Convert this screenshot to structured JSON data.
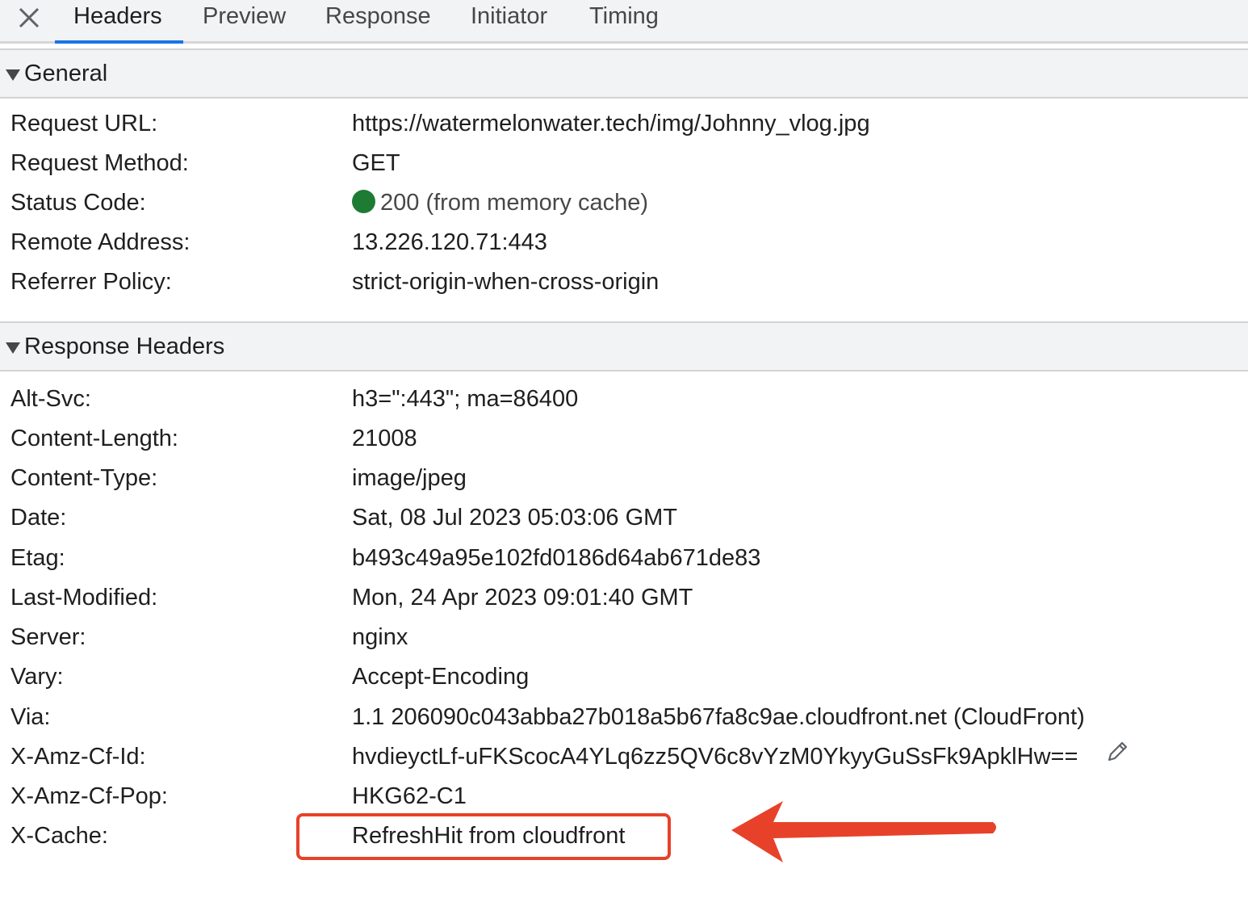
{
  "tabs": [
    {
      "label": "Headers",
      "active": true
    },
    {
      "label": "Preview"
    },
    {
      "label": "Response"
    },
    {
      "label": "Initiator"
    },
    {
      "label": "Timing"
    }
  ],
  "icons": {
    "close": "close-icon",
    "collapse": "triangle-down-icon",
    "edit": "pencil-icon",
    "annotation": "red-arrow-icon"
  },
  "colors": {
    "status_ok": "#1e7b34",
    "annotation": "#e8412a",
    "tab_accent": "#1a73e8"
  },
  "general": {
    "title": "General",
    "rows": [
      {
        "key": "Request URL:",
        "value": "https://watermelonwater.tech/img/Johnny_vlog.jpg"
      },
      {
        "key": "Request Method:",
        "value": "GET"
      },
      {
        "key": "Status Code:",
        "value": "200 (from memory cache)"
      },
      {
        "key": "Remote Address:",
        "value": "13.226.120.71:443"
      },
      {
        "key": "Referrer Policy:",
        "value": "strict-origin-when-cross-origin"
      }
    ]
  },
  "response_headers": {
    "title": "Response Headers",
    "rows": [
      {
        "key": "Alt-Svc:",
        "value": "h3=\":443\"; ma=86400"
      },
      {
        "key": "Content-Length:",
        "value": "21008"
      },
      {
        "key": "Content-Type:",
        "value": "image/jpeg"
      },
      {
        "key": "Date:",
        "value": "Sat, 08 Jul 2023 05:03:06 GMT"
      },
      {
        "key": "Etag:",
        "value": "b493c49a95e102fd0186d64ab671de83"
      },
      {
        "key": "Last-Modified:",
        "value": "Mon, 24 Apr 2023 09:01:40 GMT"
      },
      {
        "key": "Server:",
        "value": "nginx"
      },
      {
        "key": "Vary:",
        "value": "Accept-Encoding"
      },
      {
        "key": "Via:",
        "value": "1.1 206090c043abba27b018a5b67fa8c9ae.cloudfront.net (CloudFront)"
      },
      {
        "key": "X-Amz-Cf-Id:",
        "value": "hvdieyctLf-uFKScocA4YLq6zz5QV6c8vYzM0YkyyGuSsFk9ApklHw=="
      },
      {
        "key": "X-Amz-Cf-Pop:",
        "value": "HKG62-C1"
      },
      {
        "key": "X-Cache:",
        "value": "RefreshHit from cloudfront"
      }
    ]
  }
}
